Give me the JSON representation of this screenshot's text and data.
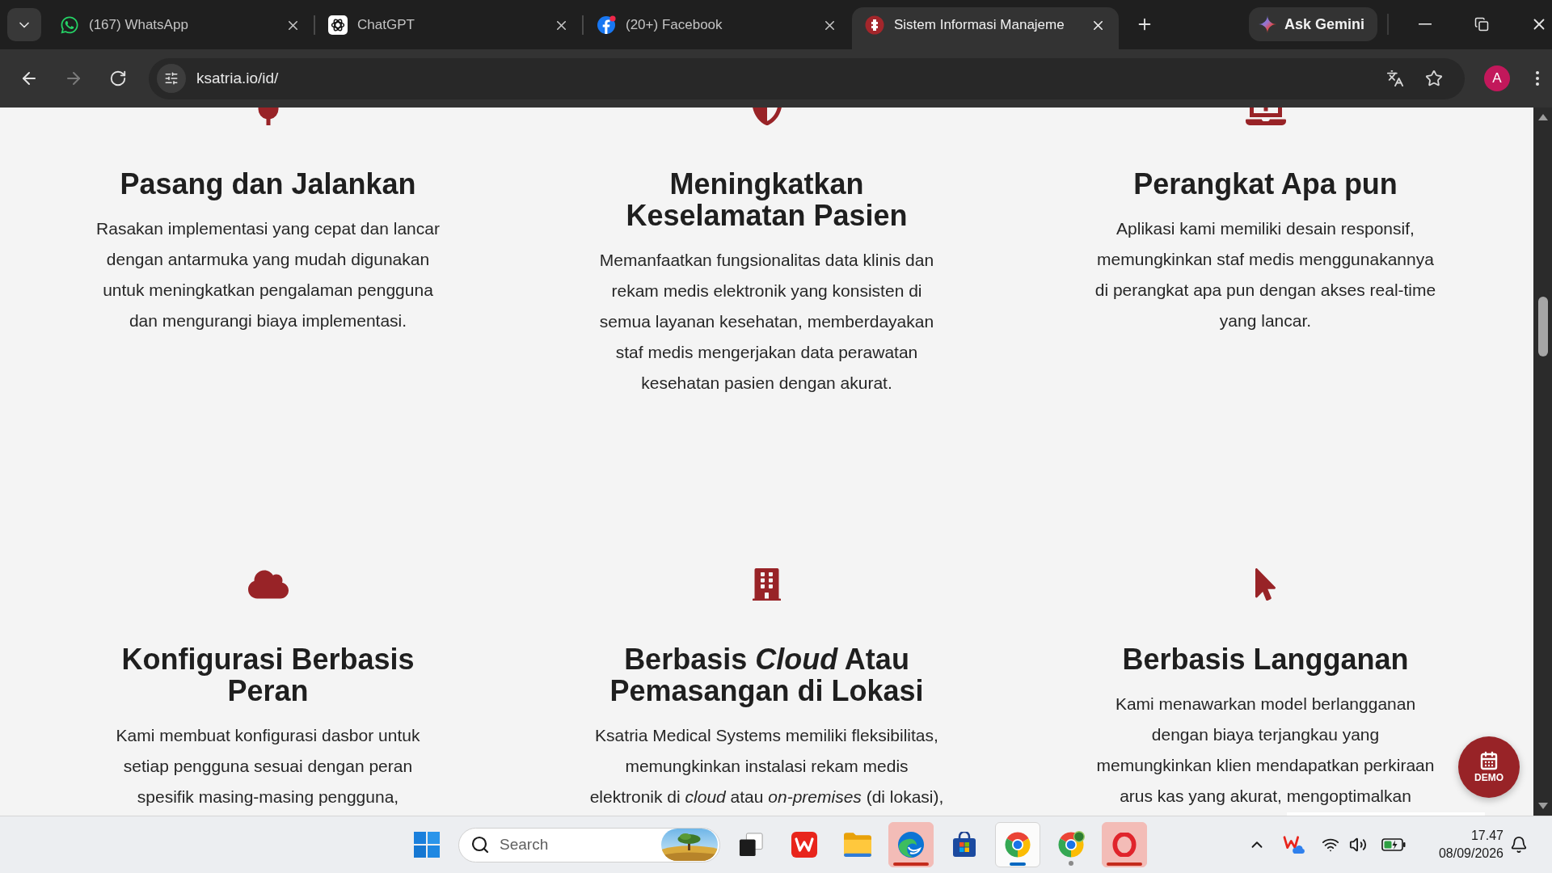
{
  "browser": {
    "tabs": [
      {
        "title": "(167) WhatsApp",
        "selected": false
      },
      {
        "title": "ChatGPT",
        "selected": false
      },
      {
        "title": "(20+) Facebook",
        "selected": false
      },
      {
        "title": "Sistem Informasi Manajeme",
        "selected": true
      }
    ],
    "assistant_button": "Ask Gemini",
    "navigation": {
      "back_disabled": false,
      "forward_disabled": true
    },
    "address": "ksatria.io/id/",
    "profile_initial": "A"
  },
  "features": [
    {
      "title": [
        "Pasang dan Jalankan"
      ],
      "description": [
        "Rasakan implementasi yang cepat dan lancar",
        "dengan antarmuka yang mudah digunakan",
        "untuk meningkatkan pengalaman pengguna",
        "dan mengurangi biaya implementasi."
      ]
    },
    {
      "title": [
        "Meningkatkan",
        "Keselamatan Pasien"
      ],
      "description": [
        "Memanfaatkan fungsionalitas data klinis dan",
        "rekam medis elektronik yang konsisten di",
        "semua layanan kesehatan, memberdayakan",
        "staf medis mengerjakan data perawatan",
        "kesehatan pasien dengan akurat."
      ]
    },
    {
      "title": [
        "Perangkat Apa pun"
      ],
      "description": [
        "Aplikasi kami memiliki desain responsif,",
        "memungkinkan staf medis menggunakannya",
        "di perangkat apa pun dengan akses real-time",
        "yang lancar."
      ]
    },
    {
      "title": [
        "Konfigurasi Berbasis",
        "Peran"
      ],
      "description": [
        "Kami membuat konfigurasi dasbor untuk",
        "setiap pengguna sesuai dengan peran",
        "spesifik masing-masing pengguna,"
      ]
    },
    {
      "title": [
        "Berbasis *Cloud* Atau",
        "Pemasangan di Lokasi"
      ],
      "description": [
        "Ksatria Medical Systems memiliki fleksibilitas,",
        "memungkinkan instalasi rekam medis",
        "elektronik di *cloud* atau *on-premises* (di lokasi),"
      ]
    },
    {
      "title": [
        "Berbasis Langganan"
      ],
      "description": [
        "Kami menawarkan model berlangganan",
        "dengan biaya terjangkau yang",
        "memungkinkan klien mendapatkan perkiraan",
        "arus kas yang akurat, mengoptimalkan"
      ]
    }
  ],
  "demo_button": "DEMO",
  "taskbar": {
    "search": {
      "placeholder": "Search"
    },
    "apps": [
      {
        "running": false,
        "active": false,
        "attention": false
      },
      {
        "running": false,
        "active": false,
        "attention": false
      },
      {
        "running": true,
        "active": false,
        "attention": true
      },
      {
        "running": false,
        "active": false,
        "attention": false
      },
      {
        "running": true,
        "active": true,
        "attention": false
      },
      {
        "running": true,
        "active": false,
        "attention": false
      },
      {
        "running": true,
        "active": false,
        "attention": true
      }
    ],
    "clock": {
      "time": "17.47",
      "date": "08/09/2026"
    }
  }
}
